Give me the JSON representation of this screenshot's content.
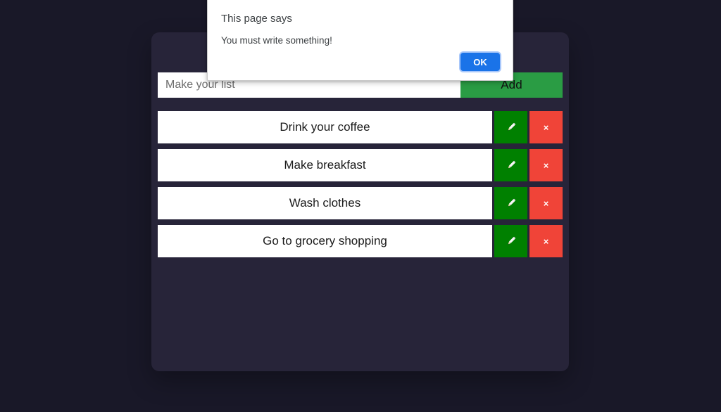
{
  "page": {
    "background_color": "#191828",
    "card_color": "#272439"
  },
  "app": {
    "input": {
      "placeholder": "Make your list",
      "value": ""
    },
    "add_button": {
      "label": "Add",
      "color": "#2a9c44"
    },
    "tasks": [
      {
        "text": "Drink your coffee",
        "edit_label": "pencil-icon",
        "delete_label": "×"
      },
      {
        "text": "Make breakfast",
        "edit_label": "pencil-icon",
        "delete_label": "×"
      },
      {
        "text": "Wash clothes",
        "edit_label": "pencil-icon",
        "delete_label": "×"
      },
      {
        "text": "Go to grocery shopping",
        "edit_label": "pencil-icon",
        "delete_label": "×"
      }
    ],
    "edit_button_color": "#008000",
    "delete_button_color": "#f04438"
  },
  "alert": {
    "title": "This page says",
    "message": "You must write something!",
    "ok_label": "OK",
    "ok_color": "#1a73e8"
  }
}
